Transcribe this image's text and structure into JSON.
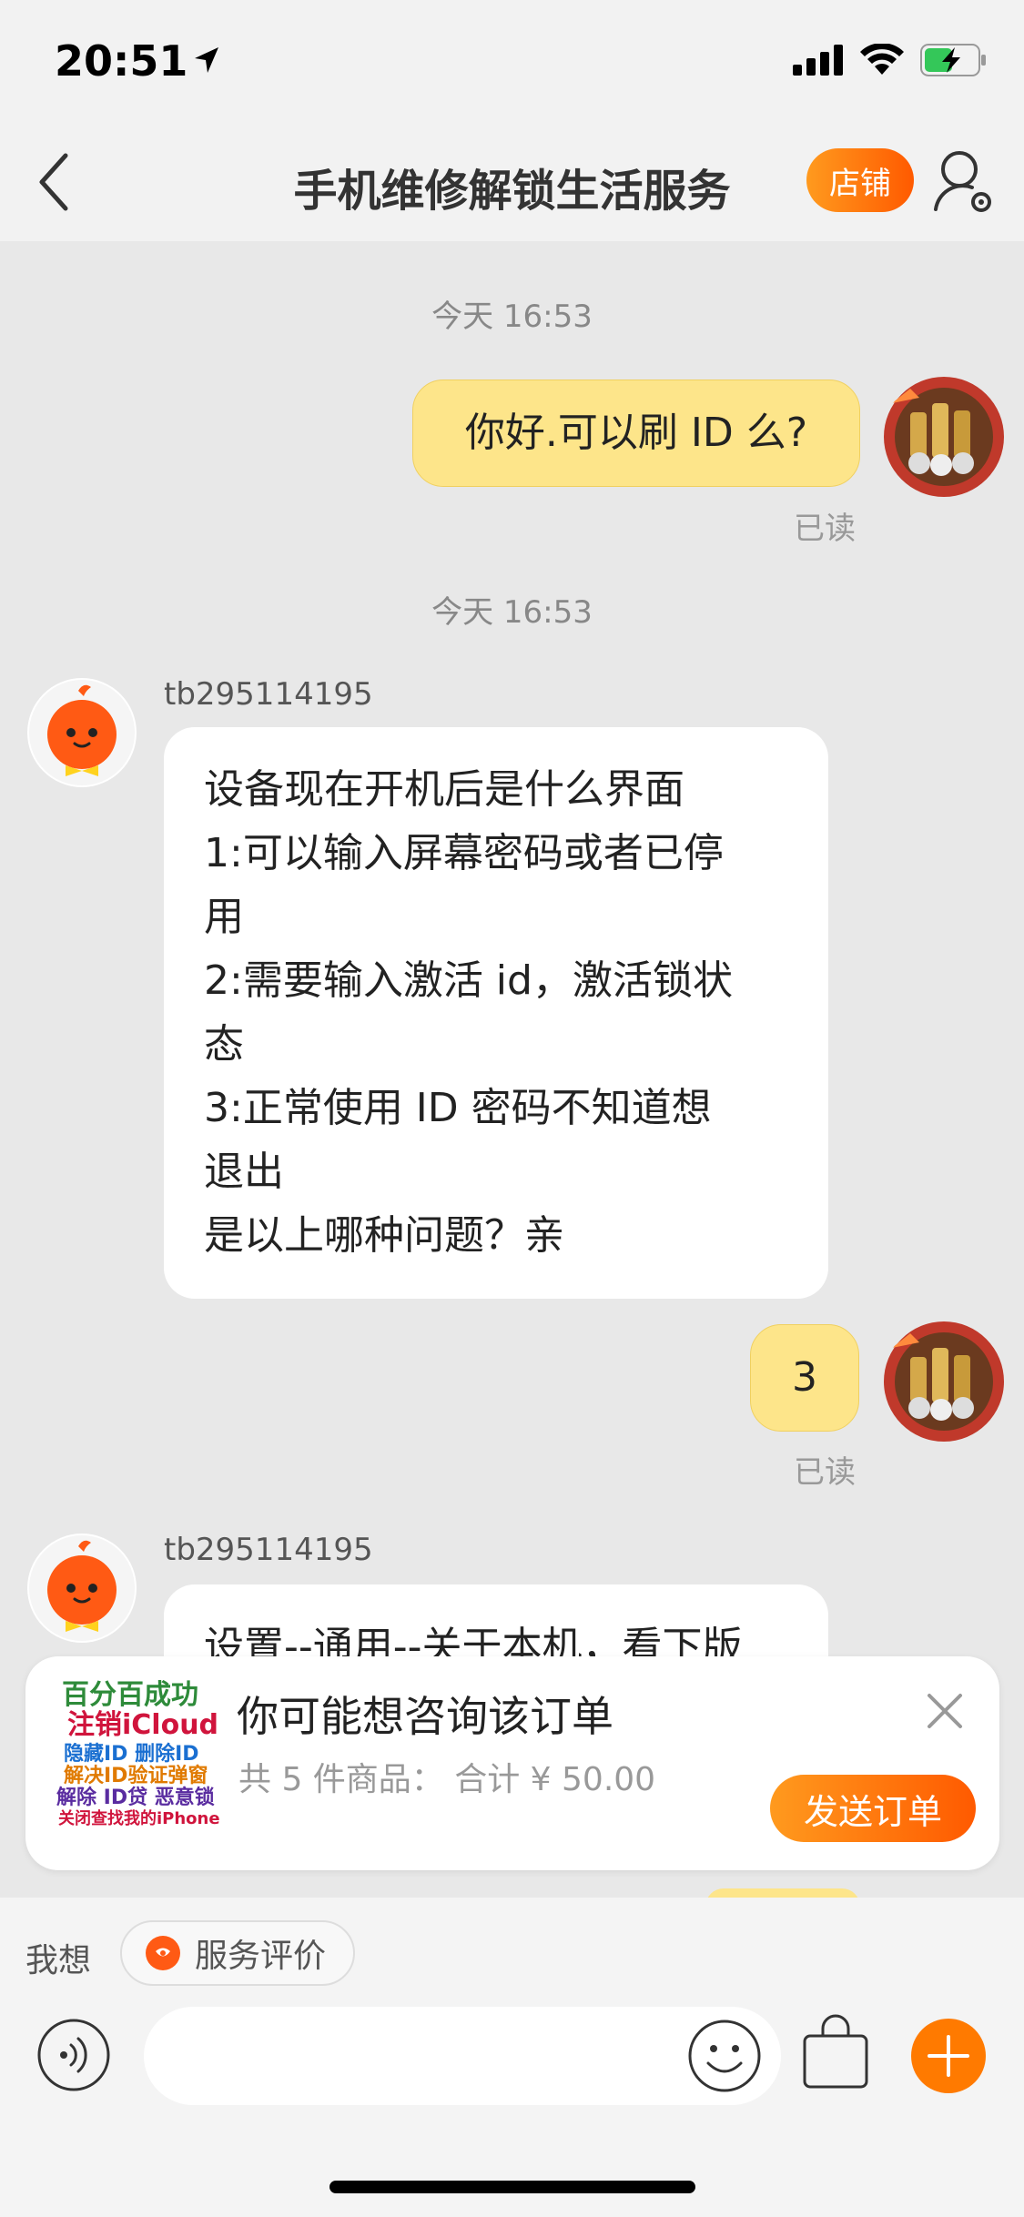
{
  "status_bar": {
    "time": "20:51"
  },
  "nav": {
    "title": "手机维修解锁生活服务",
    "shop_label": "店铺"
  },
  "messages": {
    "ts1": "今天 16:53",
    "m1": "你好.可以刷 ID 么?",
    "read1": "已读",
    "ts2": "今天 16:53",
    "sender1": "tb295114195",
    "m2_lines": [
      "设备现在开机后是什么界面",
      "1:可以输入屏幕密码或者已停",
      "用",
      "2:需要输入激活 id，激活锁状",
      "态",
      "3:正常使用 ID 密码不知道想",
      "退出",
      "是以上哪种问题？亲"
    ],
    "m3": "3",
    "read2": "已读",
    "sender2": "tb295114195",
    "m4_partial": "设置--通用--关于本机，看下版"
  },
  "order_card": {
    "thumb_lines": [
      "百分百成功",
      "注销iCloud",
      "隐藏ID 删除ID",
      "解决ID验证弹窗",
      "解除 ID贷 恶意锁",
      "关闭查找我的iPhone"
    ],
    "title": "你可能想咨询该订单",
    "summary": "共 5 件商品：  合计 ¥ 50.00",
    "send_label": "发送订单"
  },
  "bottom_bar": {
    "wish_label": "我想",
    "chip_label": "服务评价",
    "input_placeholder": ""
  },
  "colors": {
    "accent": "#ff6a00",
    "my_bubble": "#fde58a",
    "background": "#e8e8e8"
  }
}
